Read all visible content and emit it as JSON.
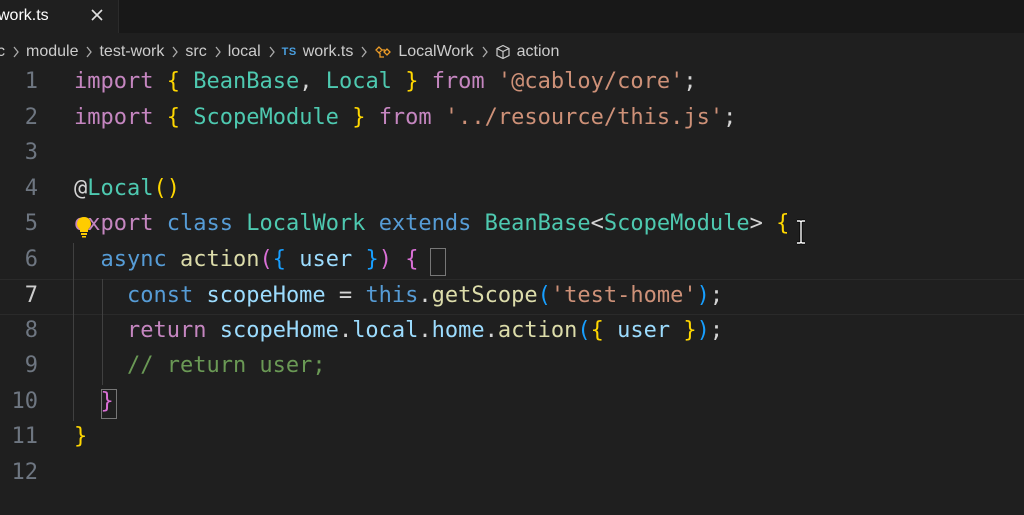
{
  "tab": {
    "label": "work.ts",
    "close": "close-tab"
  },
  "breadcrumb": {
    "items": [
      "c",
      "module",
      "test-work",
      "src",
      "local",
      "work.ts",
      "LocalWork",
      "action"
    ],
    "file_icon_text": "TS"
  },
  "lines": [
    {
      "n": "1",
      "tokens": [
        [
          "import",
          "kw-purple"
        ],
        [
          " ",
          "pl"
        ],
        [
          "{",
          "b1"
        ],
        [
          " ",
          "pl"
        ],
        [
          "BeanBase",
          "cls"
        ],
        [
          ", ",
          "pl"
        ],
        [
          "Local",
          "cls"
        ],
        [
          " ",
          "pl"
        ],
        [
          "}",
          "b1"
        ],
        [
          " ",
          "pl"
        ],
        [
          "from",
          "kw-purple"
        ],
        [
          " ",
          "pl"
        ],
        [
          "'@cabloy/core'",
          "str"
        ],
        [
          ";",
          "pl"
        ]
      ]
    },
    {
      "n": "2",
      "tokens": [
        [
          "import",
          "kw-purple"
        ],
        [
          " ",
          "pl"
        ],
        [
          "{",
          "b1"
        ],
        [
          " ",
          "pl"
        ],
        [
          "ScopeModule",
          "cls"
        ],
        [
          " ",
          "pl"
        ],
        [
          "}",
          "b1"
        ],
        [
          " ",
          "pl"
        ],
        [
          "from",
          "kw-purple"
        ],
        [
          " ",
          "pl"
        ],
        [
          "'../resource/this.js'",
          "str"
        ],
        [
          ";",
          "pl"
        ]
      ]
    },
    {
      "n": "3",
      "tokens": []
    },
    {
      "n": "4",
      "tokens": [
        [
          "@",
          "pl"
        ],
        [
          "Local",
          "cls"
        ],
        [
          "()",
          "b1"
        ]
      ]
    },
    {
      "n": "5",
      "tokens": [
        [
          "export",
          "kw-purple"
        ],
        [
          " ",
          "pl"
        ],
        [
          "class",
          "kw-blue"
        ],
        [
          " ",
          "pl"
        ],
        [
          "LocalWork",
          "cls"
        ],
        [
          " ",
          "pl"
        ],
        [
          "extends",
          "kw-blue"
        ],
        [
          " ",
          "pl"
        ],
        [
          "BeanBase",
          "cls"
        ],
        [
          "<",
          "pl"
        ],
        [
          "ScopeModule",
          "cls"
        ],
        [
          ">",
          "pl"
        ],
        [
          " ",
          "pl"
        ],
        [
          "{",
          "b1"
        ]
      ]
    },
    {
      "n": "6",
      "tokens": [
        [
          "  ",
          "pl"
        ],
        [
          "async",
          "kw-blue"
        ],
        [
          " ",
          "pl"
        ],
        [
          "action",
          "fn"
        ],
        [
          "(",
          "b2"
        ],
        [
          "{",
          "b3"
        ],
        [
          " ",
          "pl"
        ],
        [
          "user",
          "var"
        ],
        [
          " ",
          "pl"
        ],
        [
          "}",
          "b3"
        ],
        [
          ")",
          "b2"
        ],
        [
          " ",
          "pl"
        ],
        [
          "{",
          "b2"
        ]
      ]
    },
    {
      "n": "7",
      "tokens": [
        [
          "    ",
          "pl"
        ],
        [
          "const",
          "kw-blue"
        ],
        [
          " ",
          "pl"
        ],
        [
          "scopeHome",
          "var"
        ],
        [
          " = ",
          "pl"
        ],
        [
          "this",
          "kw-blue"
        ],
        [
          ".",
          "pl"
        ],
        [
          "getScope",
          "fn"
        ],
        [
          "(",
          "b3"
        ],
        [
          "'test-home'",
          "str"
        ],
        [
          ")",
          "b3"
        ],
        [
          ";",
          "pl"
        ]
      ]
    },
    {
      "n": "8",
      "tokens": [
        [
          "    ",
          "pl"
        ],
        [
          "return",
          "kw-purple"
        ],
        [
          " ",
          "pl"
        ],
        [
          "scopeHome",
          "var"
        ],
        [
          ".",
          "pl"
        ],
        [
          "local",
          "var"
        ],
        [
          ".",
          "pl"
        ],
        [
          "home",
          "var"
        ],
        [
          ".",
          "pl"
        ],
        [
          "action",
          "fn"
        ],
        [
          "(",
          "b3"
        ],
        [
          "{",
          "b1"
        ],
        [
          " ",
          "pl"
        ],
        [
          "user",
          "var"
        ],
        [
          " ",
          "pl"
        ],
        [
          "}",
          "b1"
        ],
        [
          ")",
          "b3"
        ],
        [
          ";",
          "pl"
        ]
      ]
    },
    {
      "n": "9",
      "tokens": [
        [
          "    ",
          "pl"
        ],
        [
          "// return user;",
          "cmt"
        ]
      ]
    },
    {
      "n": "10",
      "tokens": [
        [
          "  ",
          "pl"
        ],
        [
          "}",
          "b2"
        ]
      ]
    },
    {
      "n": "11",
      "tokens": [
        [
          "}",
          "b1"
        ]
      ]
    },
    {
      "n": "12",
      "tokens": []
    }
  ],
  "active_line": "7"
}
